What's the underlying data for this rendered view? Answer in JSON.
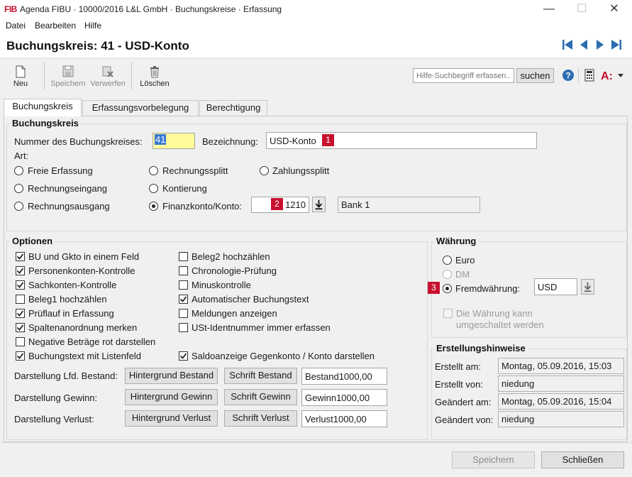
{
  "window": {
    "logo": "FIB",
    "title": "Agenda FIBU · 10000/2016 L&L GmbH · Buchungskreise · Erfassung",
    "minimize": "—",
    "maximize": "☐",
    "close": "✕"
  },
  "menu": {
    "file": "Datei",
    "edit": "Bearbeiten",
    "help": "Hilfe"
  },
  "header": {
    "title": "Buchungskreis: 41 - USD-Konto"
  },
  "toolbar": {
    "new": "Neu",
    "save": "Speichern",
    "discard": "Verwerfen",
    "delete": "Löschen",
    "search_placeholder": "Hilfe-Suchbegriff erfassen...",
    "search_button": "suchen"
  },
  "tabs": [
    "Buchungskreis",
    "Erfassungsvorbelegung",
    "Berechtigung"
  ],
  "buchungskreis": {
    "group_title": "Buchungskreis",
    "number_label": "Nummer des Buchungskreises:",
    "number_value": "41",
    "name_label": "Bezeichnung:",
    "name_value": "USD-Konto",
    "badge1": "1",
    "art_label": "Art:",
    "art_options": {
      "freie": "Freie Erfassung",
      "rsplit": "Rechnungssplitt",
      "zsplit": "Zahlungssplitt",
      "reingang": "Rechnungseingang",
      "kontierung": "Kontierung",
      "rausgang": "Rechnungsausgang",
      "finanz": "Finanzkonto/Konto:"
    },
    "selected_art": "finanz",
    "badge2": "2",
    "account_value": "1210",
    "account_name": "Bank 1"
  },
  "optionen": {
    "group_title": "Optionen",
    "left": [
      {
        "label": "BU und Gkto in einem Feld",
        "checked": true
      },
      {
        "label": "Personenkonten-Kontrolle",
        "checked": true
      },
      {
        "label": "Sachkonten-Kontrolle",
        "checked": true
      },
      {
        "label": "Beleg1 hochzählen",
        "checked": false
      },
      {
        "label": "Prüflauf in Erfassung",
        "checked": true
      },
      {
        "label": "Spaltenanordnung merken",
        "checked": true
      },
      {
        "label": "Negative Beträge rot darstellen",
        "checked": false
      },
      {
        "label": "Buchungstext mit Listenfeld",
        "checked": true
      }
    ],
    "right": [
      {
        "label": "Beleg2 hochzählen",
        "checked": false
      },
      {
        "label": "Chronologie-Prüfung",
        "checked": false
      },
      {
        "label": "Minuskontrolle",
        "checked": false
      },
      {
        "label": "Automatischer Buchungstext",
        "checked": true
      },
      {
        "label": "Meldungen anzeigen",
        "checked": false
      },
      {
        "label": "USt-Identnummer immer erfassen",
        "checked": false
      },
      {
        "label": "",
        "checked": false
      },
      {
        "label": "Saldoanzeige Gegenkonto / Konto darstellen",
        "checked": true
      }
    ],
    "rows": [
      {
        "label": "Darstellung Lfd. Bestand:",
        "bg_button": "Hintergrund Bestand",
        "font_button": "Schrift Bestand",
        "preview": "Bestand1000,00"
      },
      {
        "label": "Darstellung Gewinn:",
        "bg_button": "Hintergrund Gewinn",
        "font_button": "Schrift Gewinn",
        "preview": "Gewinn1000,00"
      },
      {
        "label": "Darstellung Verlust:",
        "bg_button": "Hintergrund Verlust",
        "font_button": "Schrift Verlust",
        "preview": "Verlust1000,00"
      }
    ]
  },
  "waehrung": {
    "group_title": "Währung",
    "euro": "Euro",
    "dm": "DM",
    "fremd": "Fremdwährung:",
    "badge3": "3",
    "currency": "USD",
    "switchable_line1": "Die Währung kann",
    "switchable_line2": "umgeschaltet werden"
  },
  "erstellung": {
    "group_title": "Erstellungshinweise",
    "created_at_label": "Erstellt am:",
    "created_at": "Montag, 05.09.2016, 15:03",
    "created_by_label": "Erstellt von:",
    "created_by": "niedung",
    "changed_at_label": "Geändert am:",
    "changed_at": "Montag, 05.09.2016, 15:04",
    "changed_by_label": "Geändert von:",
    "changed_by": "niedung"
  },
  "footer": {
    "save": "Speichern",
    "close": "Schließen"
  },
  "colors": {
    "accent_red": "#c8102e",
    "nav_blue": "#2b6cb0",
    "selection": "#fffb9b"
  }
}
